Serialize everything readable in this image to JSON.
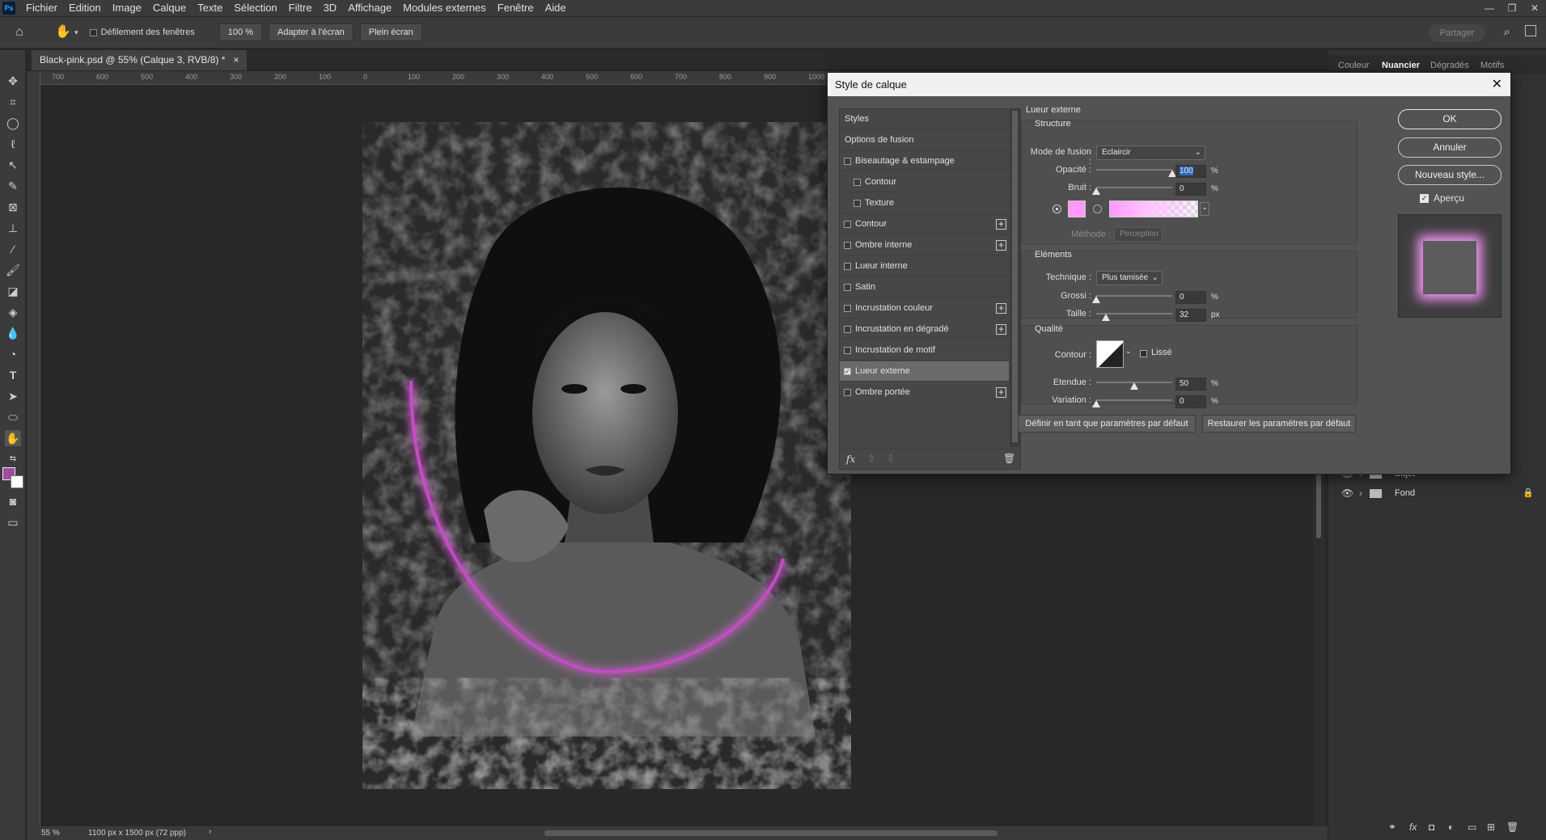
{
  "menubar": {
    "logo": "Ps",
    "items": [
      "Fichier",
      "Edition",
      "Image",
      "Calque",
      "Texte",
      "Sélection",
      "Filtre",
      "3D",
      "Affichage",
      "Modules externes",
      "Fenêtre",
      "Aide"
    ]
  },
  "options": {
    "scroll_all_windows": "Défilement des fenêtres",
    "zoom_value": "100 %",
    "fit_screen": "Adapter à l'écran",
    "full_screen": "Plein écran",
    "share": "Partager"
  },
  "document": {
    "tab_title": "Black-pink.psd @ 55% (Calque 3, RVB/8) *",
    "close": "×"
  },
  "rulers": {
    "h": [
      "700",
      "600",
      "500",
      "400",
      "300",
      "200",
      "100",
      "0",
      "100",
      "200",
      "300",
      "400",
      "500",
      "600",
      "700",
      "800",
      "900",
      "1000"
    ]
  },
  "status": {
    "zoom": "55 %",
    "doc_size": "1100 px x 1500 px (72 ppp)"
  },
  "right_panel": {
    "tabs": [
      "Couleur",
      "Nuancier",
      "Dégradés",
      "Motifs"
    ],
    "active_tab": "Nuancier",
    "layers": [
      {
        "name": "Sujet",
        "locked": false
      },
      {
        "name": "Fond",
        "locked": true
      }
    ]
  },
  "dialog": {
    "title": "Style de calque",
    "styles_header": "Styles",
    "blend_options": "Options de fusion",
    "style_items": [
      {
        "label": "Biseautage & estampage",
        "checked": false,
        "indent": false,
        "plus": false
      },
      {
        "label": "Contour",
        "checked": false,
        "indent": true,
        "plus": false
      },
      {
        "label": "Texture",
        "checked": false,
        "indent": true,
        "plus": false
      },
      {
        "label": "Contour",
        "checked": false,
        "indent": false,
        "plus": true
      },
      {
        "label": "Ombre interne",
        "checked": false,
        "indent": false,
        "plus": true
      },
      {
        "label": "Lueur interne",
        "checked": false,
        "indent": false,
        "plus": false
      },
      {
        "label": "Satin",
        "checked": false,
        "indent": false,
        "plus": false
      },
      {
        "label": "Incrustation couleur",
        "checked": false,
        "indent": false,
        "plus": true
      },
      {
        "label": "Incrustation en dégradé",
        "checked": false,
        "indent": false,
        "plus": true
      },
      {
        "label": "Incrustation de motif",
        "checked": false,
        "indent": false,
        "plus": false
      },
      {
        "label": "Lueur externe",
        "checked": true,
        "indent": false,
        "plus": false,
        "selected": true
      },
      {
        "label": "Ombre portée",
        "checked": false,
        "indent": false,
        "plus": true
      }
    ],
    "section_title": "Lueur externe",
    "structure": {
      "label": "Structure",
      "blend_mode_label": "Mode de fusion :",
      "blend_mode": "Eclaircir",
      "opacity_label": "Opacité :",
      "opacity": 100,
      "noise_label": "Bruit :",
      "noise": 0,
      "unit_percent": "%",
      "glow_color": "#ff99ff",
      "method_label": "Méthode :",
      "method": "Perception"
    },
    "elements": {
      "label": "Eléments",
      "technique_label": "Technique :",
      "technique": "Plus tamisée",
      "spread_label": "Grossi :",
      "spread": 0,
      "size_label": "Taille :",
      "size": 32,
      "unit_px": "px"
    },
    "quality": {
      "label": "Qualité",
      "contour_label": "Contour :",
      "antialias_label": "Lissé",
      "range_label": "Etendue :",
      "range": 50,
      "jitter_label": "Variation :",
      "jitter": 0
    },
    "make_default": "Définir en tant que paramètres par défaut",
    "reset_default": "Restaurer les paramètres par défaut",
    "ok": "OK",
    "cancel": "Annuler",
    "new_style": "Nouveau style...",
    "preview_label": "Aperçu",
    "fx_label": "fx"
  }
}
